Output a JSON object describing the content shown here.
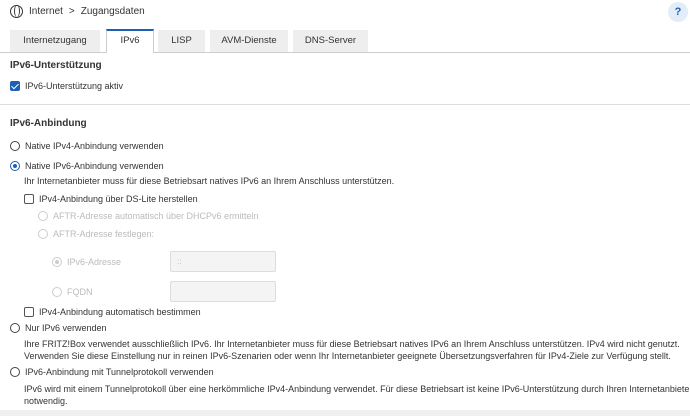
{
  "breadcrumb": {
    "root": "Internet",
    "separator": ">",
    "current": "Zugangsdaten"
  },
  "help_label": "?",
  "tabs": [
    {
      "label": "Internetzugang"
    },
    {
      "label": "IPv6"
    },
    {
      "label": "LISP"
    },
    {
      "label": "AVM-Dienste"
    },
    {
      "label": "DNS-Server"
    }
  ],
  "support": {
    "heading": "IPv6-Unterstützung",
    "checkbox_label": "IPv6-Unterstützung aktiv",
    "checked": true
  },
  "binding": {
    "heading": "IPv6-Anbindung",
    "native_v4": "Native IPv4-Anbindung verwenden",
    "native_v6": "Native IPv6-Anbindung verwenden",
    "native_v6_desc": "Ihr Internetanbieter muss für diese Betriebsart natives IPv6 an Ihrem Anschluss unterstützen.",
    "dslite": "IPv4-Anbindung über DS-Lite herstellen",
    "aftr_auto": "AFTR-Adresse automatisch über DHCPv6 ermitteln",
    "aftr_fixed": "AFTR-Adresse festlegen:",
    "ipv6_addr_label": "IPv6-Adresse",
    "ipv6_addr_value": "::",
    "fqdn_label": "FQDN",
    "fqdn_value": "",
    "auto_v4": "IPv4-Anbindung automatisch bestimmen",
    "only_v6": "Nur IPv6 verwenden",
    "only_v6_desc1": "Ihre FRITZ!Box verwendet ausschließlich IPv6. Ihr Internetanbieter muss für diese Betriebsart natives IPv6 an Ihrem Anschluss unterstützen. IPv4 wird nicht genutzt.",
    "only_v6_desc2": "Verwenden Sie diese Einstellung nur in reinen IPv6-Szenarien oder wenn Ihr Internetanbieter geeignete Übersetzungsverfahren für IPv4-Ziele zur Verfügung stellt.",
    "tunnel": "IPv6-Anbindung mit Tunnelprotokoll verwenden",
    "tunnel_desc1": "IPv6 wird mit einem Tunnelprotokoll über eine herkömmliche IPv4-Anbindung verwendet. Für diese Betriebsart ist keine IPv6-Unterstützung durch Ihren Internetanbieter",
    "tunnel_desc2": "notwendig."
  }
}
